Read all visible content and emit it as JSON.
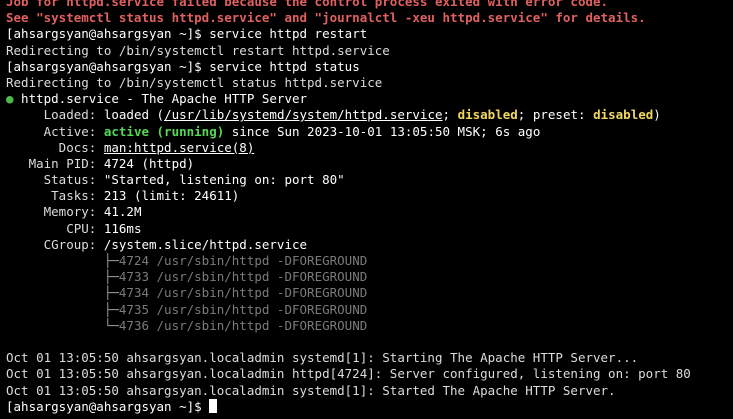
{
  "error_lines": [
    "Job for httpd.service failed because the control process exited with error code.",
    "See \"systemctl status httpd.service\" and \"journalctl -xeu httpd.service\" for details."
  ],
  "prompt": "[ahsargsyan@ahsargsyan ~]$ ",
  "cmd_restart": "service httpd restart",
  "redirect_restart": "Redirecting to /bin/systemctl restart httpd.service",
  "cmd_status": "service httpd status",
  "redirect_status": "Redirecting to /bin/systemctl status httpd.service",
  "service": {
    "bullet": "●",
    "title": " httpd.service - The Apache HTTP Server",
    "loaded_label": "     Loaded: ",
    "loaded_pre": "loaded (",
    "loaded_path": "/usr/lib/systemd/system/httpd.service",
    "loaded_sep1": "; ",
    "loaded_state": "disabled",
    "loaded_sep2": "; preset: ",
    "loaded_preset": "disabled",
    "loaded_post": ")",
    "active_label": "     Active: ",
    "active_state": "active (running)",
    "active_since": " since Sun 2023-10-01 13:05:50 MSK; 6s ago",
    "docs_label": "       Docs: ",
    "docs_value": "man:httpd.service(8)",
    "pid_label": "   Main PID: ",
    "pid_value": "4724 (httpd)",
    "status_label": "     Status: ",
    "status_value": "\"Started, listening on: port 80\"",
    "tasks_label": "      Tasks: ",
    "tasks_value": "213 (limit: 24611)",
    "memory_label": "     Memory: ",
    "memory_value": "41.2M",
    "cpu_label": "        CPU: ",
    "cpu_value": "116ms",
    "cgroup_label": "     CGroup: ",
    "cgroup_value": "/system.slice/httpd.service",
    "processes": [
      {
        "branch": "             ├─",
        "pid": "4724",
        "cmd": " /usr/sbin/httpd -DFOREGROUND"
      },
      {
        "branch": "             ├─",
        "pid": "4733",
        "cmd": " /usr/sbin/httpd -DFOREGROUND"
      },
      {
        "branch": "             ├─",
        "pid": "4734",
        "cmd": " /usr/sbin/httpd -DFOREGROUND"
      },
      {
        "branch": "             ├─",
        "pid": "4735",
        "cmd": " /usr/sbin/httpd -DFOREGROUND"
      },
      {
        "branch": "             └─",
        "pid": "4736",
        "cmd": " /usr/sbin/httpd -DFOREGROUND"
      }
    ]
  },
  "log_lines": [
    "Oct 01 13:05:50 ahsargsyan.localadmin systemd[1]: Starting The Apache HTTP Server...",
    "Oct 01 13:05:50 ahsargsyan.localadmin httpd[4724]: Server configured, listening on: port 80",
    "Oct 01 13:05:50 ahsargsyan.localadmin systemd[1]: Started The Apache HTTP Server."
  ],
  "final_prompt": "[ahsargsyan@ahsargsyan ~]$ ",
  "colors": {
    "background": "#000000",
    "error": "#e06060",
    "active": "#56d756",
    "disabled": "#f0d860",
    "tree": "#7a7a7a"
  }
}
